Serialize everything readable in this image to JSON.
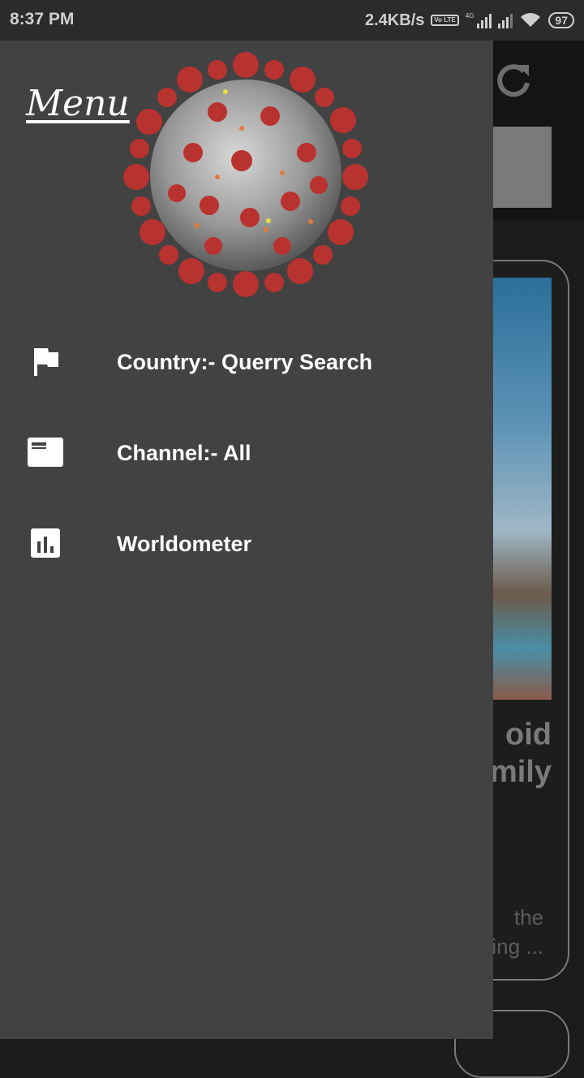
{
  "status_bar": {
    "time": "8:37 PM",
    "speed": "2.4KB/s",
    "volte": "Vo LTE",
    "network_type": "4G",
    "battery": "97"
  },
  "drawer": {
    "title": "Menu",
    "header_image": "coronavirus-illustration",
    "items": [
      {
        "label": "Country:- Querry Search",
        "icon": "flag-icon"
      },
      {
        "label": "Channel:- All",
        "icon": "featured-video-icon"
      },
      {
        "label": "Worldometer",
        "icon": "bar-chart-icon"
      }
    ]
  },
  "background": {
    "card_title": "oid\nmily",
    "card_desc": "the\ning ..."
  }
}
